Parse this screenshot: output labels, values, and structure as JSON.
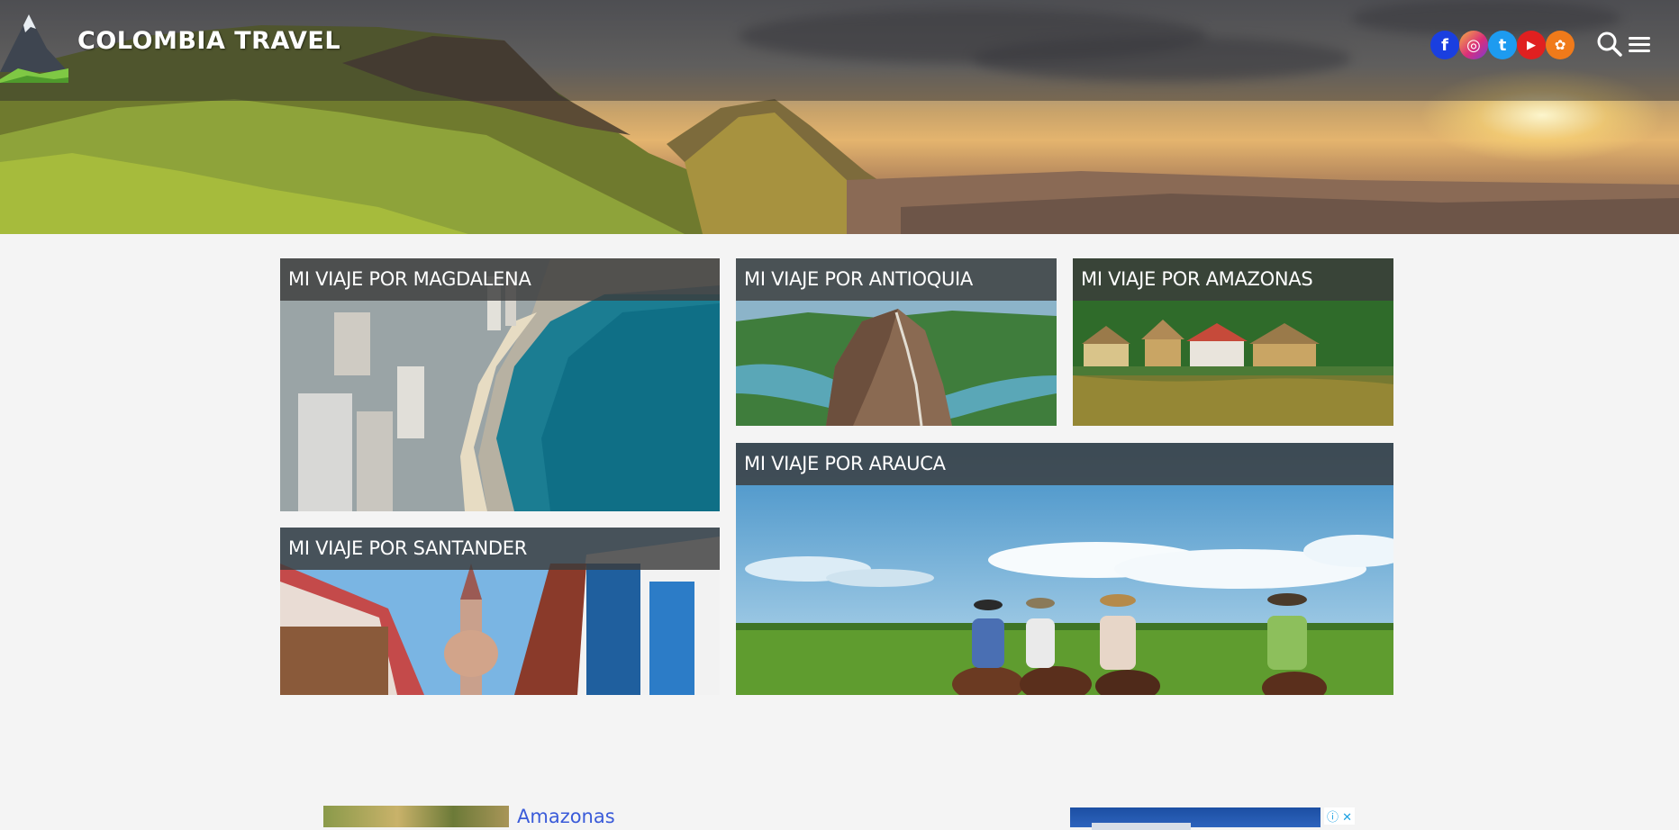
{
  "header": {
    "brand": "COLOMBIA TRAVEL",
    "social": [
      {
        "name": "facebook-icon",
        "glyph": "f",
        "color": "#1a3fe0"
      },
      {
        "name": "instagram-icon",
        "glyph": "◎",
        "color": "#d94a8a"
      },
      {
        "name": "twitter-icon",
        "glyph": "t",
        "color": "#1d9bf0"
      },
      {
        "name": "youtube-icon",
        "glyph": "▶",
        "color": "#e02020"
      },
      {
        "name": "snapchat-icon",
        "glyph": "✿",
        "color": "#f07a1a"
      }
    ],
    "search_icon": "search-icon",
    "menu_icon": "hamburger-menu-icon"
  },
  "cards": {
    "magdalena": "MI VIAJE POR MAGDALENA",
    "antioquia": "MI VIAJE POR ANTIOQUIA",
    "amazonas": "MI VIAJE POR AMAZONAS",
    "arauca": "MI VIAJE POR ARAUCA",
    "santander": "MI VIAJE POR SANTANDER"
  },
  "related": {
    "link": "Amazonas"
  },
  "ad": {
    "choices_icon": "ⓘ ✕"
  }
}
